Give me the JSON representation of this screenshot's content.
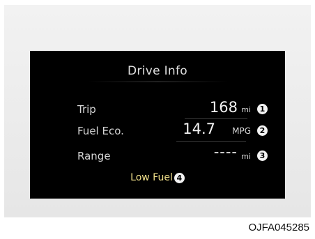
{
  "display": {
    "title": "Drive Info",
    "rows": [
      {
        "label": "Trip",
        "value": "168",
        "unit": "mi",
        "marker": "1"
      },
      {
        "label": "Fuel Eco.",
        "value": "14.7",
        "unit": "MPG",
        "marker": "2"
      },
      {
        "label": "Range",
        "value": "----",
        "unit": "mi",
        "marker": "3"
      }
    ],
    "warning": {
      "text": "Low Fuel",
      "marker": "4",
      "color": "#f1e08a"
    }
  },
  "caption": "OJFA045285"
}
